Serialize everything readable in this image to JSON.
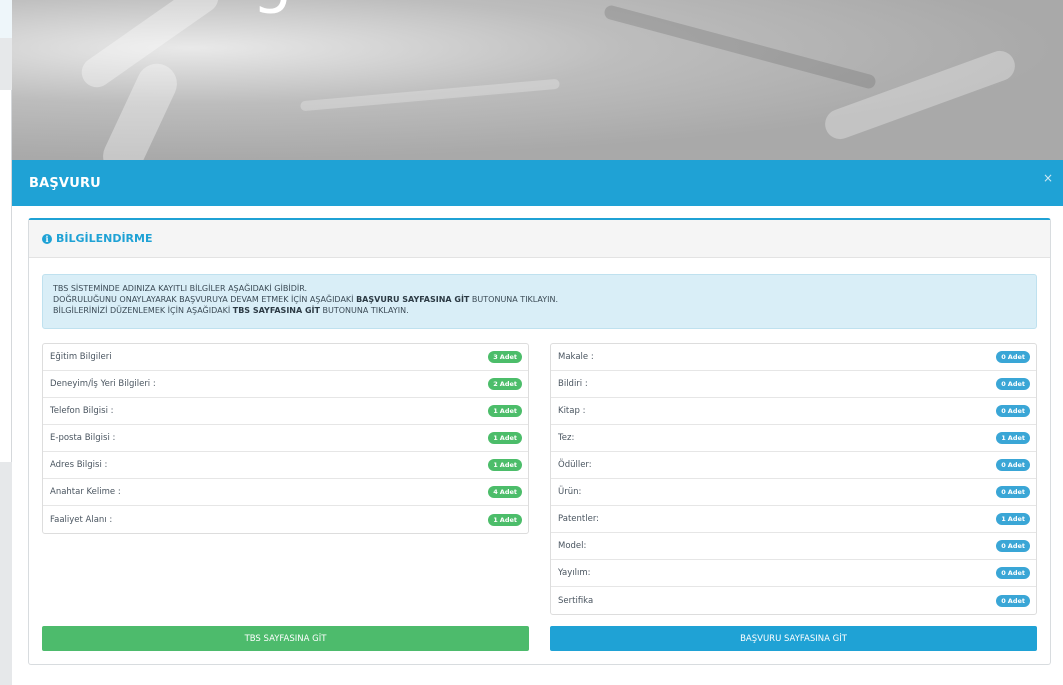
{
  "colors": {
    "header_blue": "#1fa2d5",
    "success_green": "#4dbb6c",
    "badge_blue": "#3aa6d6",
    "alert_bg": "#d9eef7"
  },
  "background": {
    "hero_glyph": "g"
  },
  "modal": {
    "title": "BAŞVURU",
    "close_label": "×",
    "panel_title": "BİLGİLENDİRME",
    "info_icon_glyph": "i",
    "alert": {
      "line1": "TBS SİSTEMİNDE ADINIZA KAYITLI BİLGİLER AŞAĞIDAKİ GİBİDİR.",
      "line2_pre": "DOĞRULUĞUNU ONAYLAYARAK BAŞVURUYA DEVAM ETMEK İÇİN AŞAĞIDAKİ ",
      "line2_bold": "BAŞVURU SAYFASINA GİT",
      "line2_post": " BUTONUNA TIKLAYIN.",
      "line3_pre": "BİLGİLERİNİZİ DÜZENLEMEK İÇİN AŞAĞIDAKİ ",
      "line3_bold": "TBS SAYFASINA GİT",
      "line3_post": " BUTONUNA TIKLAYIN."
    },
    "left_items": [
      {
        "label": "Eğitim Bilgileri",
        "count": "3",
        "unit": "Adet"
      },
      {
        "label": "Deneyim/İş Yeri Bilgileri :",
        "count": "2",
        "unit": "Adet"
      },
      {
        "label": "Telefon Bilgisi :",
        "count": "1",
        "unit": "Adet"
      },
      {
        "label": "E-posta Bilgisi :",
        "count": "1",
        "unit": "Adet"
      },
      {
        "label": "Adres Bilgisi :",
        "count": "1",
        "unit": "Adet"
      },
      {
        "label": "Anahtar Kelime :",
        "count": "4",
        "unit": "Adet"
      },
      {
        "label": "Faaliyet Alanı :",
        "count": "1",
        "unit": "Adet"
      }
    ],
    "right_items": [
      {
        "label": "Makale :",
        "count": "0",
        "unit": "Adet"
      },
      {
        "label": "Bildiri :",
        "count": "0",
        "unit": "Adet"
      },
      {
        "label": "Kitap :",
        "count": "0",
        "unit": "Adet"
      },
      {
        "label": "Tez:",
        "count": "1",
        "unit": "Adet"
      },
      {
        "label": "Ödüller:",
        "count": "0",
        "unit": "Adet"
      },
      {
        "label": "Ürün:",
        "count": "0",
        "unit": "Adet"
      },
      {
        "label": "Patentler:",
        "count": "1",
        "unit": "Adet"
      },
      {
        "label": "Model:",
        "count": "0",
        "unit": "Adet"
      },
      {
        "label": "Yayılım:",
        "count": "0",
        "unit": "Adet"
      },
      {
        "label": "Sertifika",
        "count": "0",
        "unit": "Adet"
      }
    ],
    "buttons": {
      "tbs": "TBS SAYFASINA GİT",
      "basvuru": "BAŞVURU SAYFASINA GİT"
    }
  }
}
